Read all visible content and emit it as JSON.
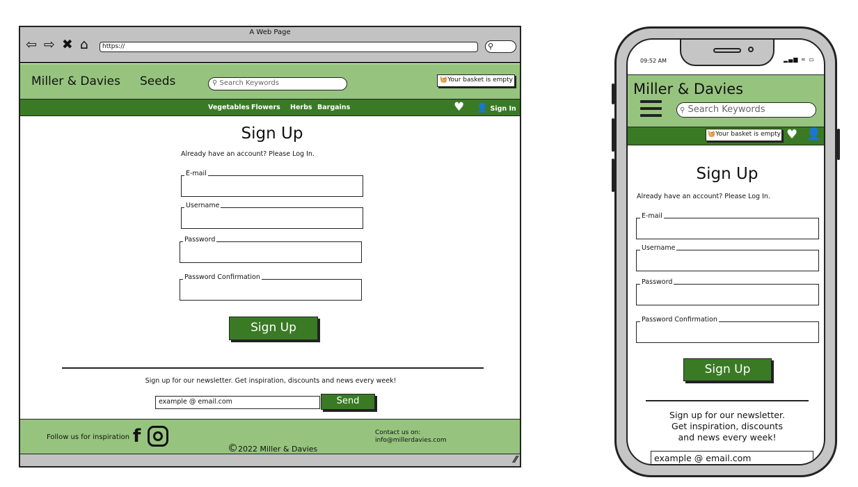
{
  "desktop": {
    "window_title": "A Web Page",
    "nav_icons": "⇦ ⇨ ✖ ⌂",
    "url": "https://",
    "header": {
      "brand": "Miller & Davies",
      "brand_suffix": "Seeds",
      "search_placeholder": "Search Keywords",
      "basket": "Your basket is empty"
    },
    "nav": {
      "links": [
        "Vegetables",
        "Flowers",
        "Herbs",
        "Bargains"
      ],
      "sign_in": "Sign In"
    },
    "form": {
      "title": "Sign Up",
      "login_hint": "Already have an account? Please Log In.",
      "fields": [
        "E-mail",
        "Username",
        "Password",
        "Password Confirmation"
      ],
      "submit": "Sign Up"
    },
    "newsletter": {
      "text": "Sign up for our newsletter. Get inspiration, discounts and news every week!",
      "input_value": "example @ email.com",
      "send": "Send"
    },
    "footer": {
      "follow": "Follow us for inspiration",
      "copyright": "2022 Miller & Davies",
      "contact_label": "Contact us on:",
      "contact_email": "info@millerdavies.com"
    }
  },
  "mobile": {
    "time": "09:52 AM",
    "brand": "Miller & Davies",
    "search_placeholder": "Search Keywords",
    "basket": "Your basket is empty",
    "form": {
      "title": "Sign Up",
      "login_hint": "Already have an account? Please Log In.",
      "fields": [
        "E-mail",
        "Username",
        "Password",
        "Password Confirmation"
      ],
      "submit": "Sign Up"
    },
    "newsletter": {
      "line1": "Sign up for our newsletter.",
      "line2": "Get inspiration, discounts",
      "line3": "and news every week!",
      "input_value": "example @ email.com"
    }
  },
  "colors": {
    "header_green": "#96c47e",
    "nav_green": "#3a7a25",
    "frame_grey": "#c2c2c2"
  }
}
